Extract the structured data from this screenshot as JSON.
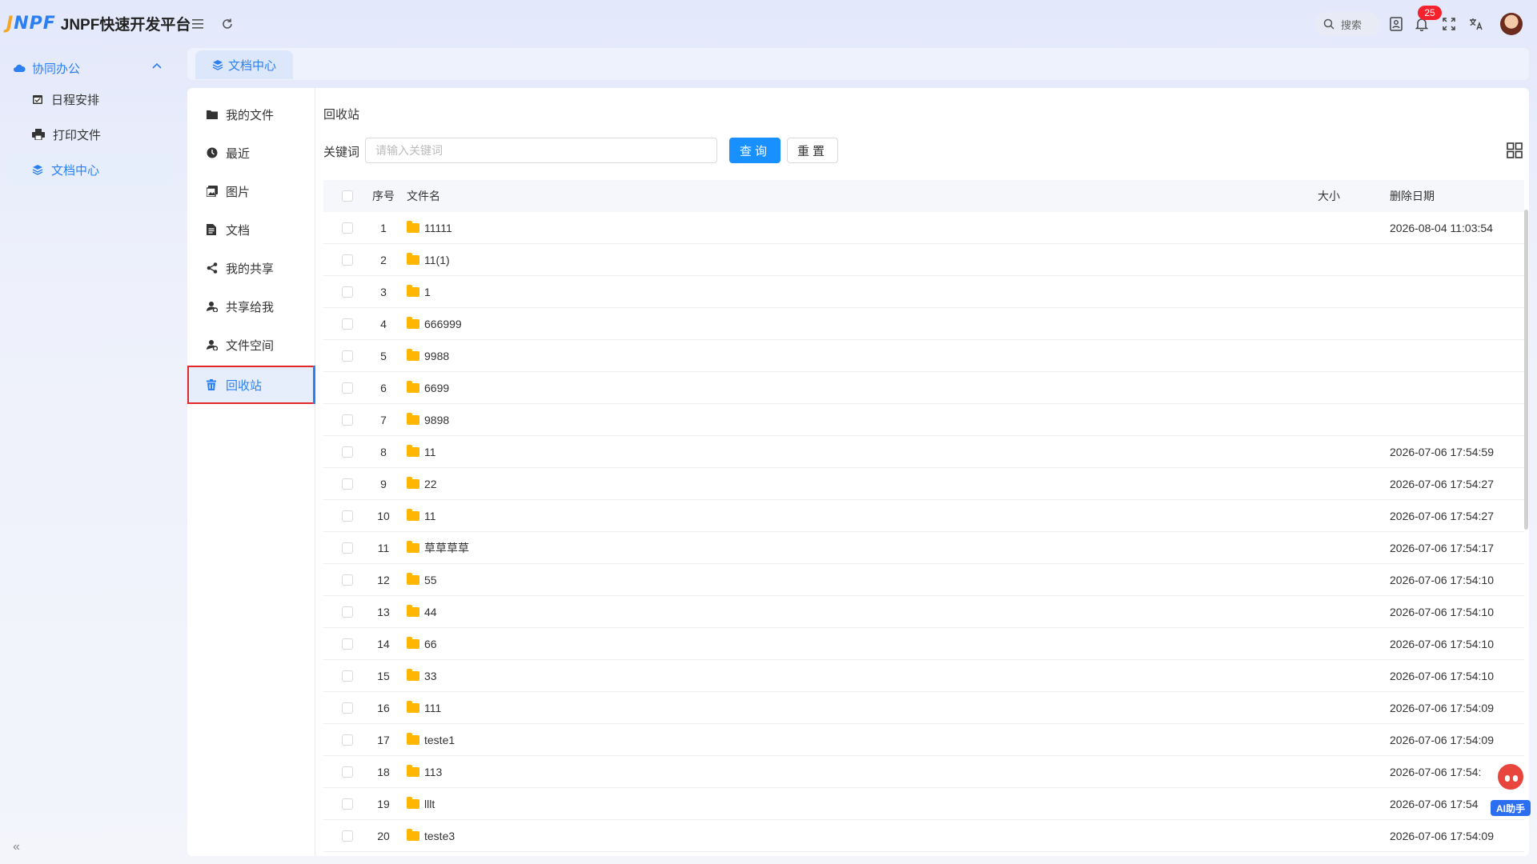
{
  "app": {
    "logo_mark_j": "J",
    "logo_mark_rest": "NPF",
    "title": "JNPF快速开发平台"
  },
  "header": {
    "search_placeholder": "搜索",
    "notification_count": "25"
  },
  "sidebar": {
    "group_label": "协同办公",
    "items": [
      {
        "label": "日程安排",
        "icon": "calendar-icon"
      },
      {
        "label": "打印文件",
        "icon": "printer-icon"
      },
      {
        "label": "文档中心",
        "icon": "layers-icon",
        "active": true
      }
    ]
  },
  "tabs": [
    {
      "label": "文档中心"
    }
  ],
  "file_nav": [
    {
      "label": "我的文件",
      "icon": "folder-icon"
    },
    {
      "label": "最近",
      "icon": "clock-icon"
    },
    {
      "label": "图片",
      "icon": "image-icon"
    },
    {
      "label": "文档",
      "icon": "document-icon"
    },
    {
      "label": "我的共享",
      "icon": "share-icon"
    },
    {
      "label": "共享给我",
      "icon": "user-share-icon"
    },
    {
      "label": "文件空间",
      "icon": "user-space-icon"
    },
    {
      "label": "回收站",
      "icon": "trash-icon",
      "active": true
    }
  ],
  "content": {
    "section_title": "回收站",
    "keyword_label": "关键词",
    "keyword_placeholder": "请输入关键词",
    "query_button": "查询",
    "reset_button": "重置"
  },
  "table": {
    "columns": {
      "no": "序号",
      "name": "文件名",
      "size": "大小",
      "date": "删除日期"
    },
    "rows": [
      {
        "no": "1",
        "name": "11111",
        "size": "",
        "date": "2026-08-04 11:03:54"
      },
      {
        "no": "2",
        "name": "11(1)",
        "size": "",
        "date": ""
      },
      {
        "no": "3",
        "name": "1",
        "size": "",
        "date": ""
      },
      {
        "no": "4",
        "name": "666999",
        "size": "",
        "date": ""
      },
      {
        "no": "5",
        "name": "9988",
        "size": "",
        "date": ""
      },
      {
        "no": "6",
        "name": "6699",
        "size": "",
        "date": ""
      },
      {
        "no": "7",
        "name": "9898",
        "size": "",
        "date": ""
      },
      {
        "no": "8",
        "name": "11",
        "size": "",
        "date": "2026-07-06 17:54:59"
      },
      {
        "no": "9",
        "name": "22",
        "size": "",
        "date": "2026-07-06 17:54:27"
      },
      {
        "no": "10",
        "name": "11",
        "size": "",
        "date": "2026-07-06 17:54:27"
      },
      {
        "no": "11",
        "name": "草草草草",
        "size": "",
        "date": "2026-07-06 17:54:17"
      },
      {
        "no": "12",
        "name": "55",
        "size": "",
        "date": "2026-07-06 17:54:10"
      },
      {
        "no": "13",
        "name": "44",
        "size": "",
        "date": "2026-07-06 17:54:10"
      },
      {
        "no": "14",
        "name": "66",
        "size": "",
        "date": "2026-07-06 17:54:10"
      },
      {
        "no": "15",
        "name": "33",
        "size": "",
        "date": "2026-07-06 17:54:10"
      },
      {
        "no": "16",
        "name": "111",
        "size": "",
        "date": "2026-07-06 17:54:09"
      },
      {
        "no": "17",
        "name": "teste1",
        "size": "",
        "date": "2026-07-06 17:54:09"
      },
      {
        "no": "18",
        "name": "113",
        "size": "",
        "date": "2026-07-06 17:54:"
      },
      {
        "no": "19",
        "name": "lllt",
        "size": "",
        "date": "2026-07-06 17:54"
      },
      {
        "no": "20",
        "name": "teste3",
        "size": "",
        "date": "2026-07-06 17:54:09"
      }
    ]
  },
  "ai_helper": {
    "label": "AI助手"
  },
  "colors": {
    "primary": "#1890ff",
    "accent": "#2b7ff0",
    "highlight_border": "#e0282e",
    "folder": "#ffb600"
  }
}
